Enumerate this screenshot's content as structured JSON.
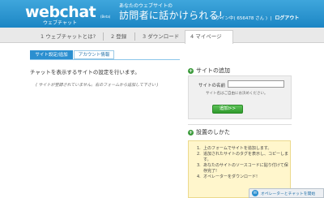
{
  "header": {
    "logo": "webchat",
    "logo_reg": "(Beta)",
    "logo_sub": "ウェブチャット",
    "tagline_small": "あなたのウェブサイトの",
    "tagline_big": "訪問者に話かけられる!",
    "login_status": "ログイン中( 656478 さん )",
    "logout": "ログアウト"
  },
  "nav": {
    "tabs": [
      {
        "label": "1 ウェブチャットとは?"
      },
      {
        "label": "2 登録"
      },
      {
        "label": "3 ダウンロード"
      },
      {
        "label": "4 マイページ"
      }
    ]
  },
  "main": {
    "sub_tabs": [
      {
        "label": "サイト設定/追加",
        "active": true
      },
      {
        "label": "アカウント情報",
        "active": false
      }
    ],
    "intro": "チャットを表示するサイトの設定を行います。",
    "note": "( サイトが登録されていません。右のフォームから追加して下さい )"
  },
  "sidebar": {
    "add_site": {
      "heading": "サイトの追加",
      "name_label": "サイトの名前",
      "name_value": "",
      "help": "サイト名はご自由にお決めください。",
      "button": "追加>>"
    },
    "setup": {
      "heading": "設置のしかた",
      "steps": [
        {
          "num": "1.",
          "text": "上のフォームでサイトを追加します。"
        },
        {
          "num": "2.",
          "text": "追加されたサイトのタグを表示し、コピーします。"
        },
        {
          "num": "3.",
          "text": "あなたのサイトのソースコードに貼り付けて保存完了!"
        },
        {
          "num": "4.",
          "text": "オペレーターをダウンロード!"
        }
      ]
    }
  },
  "chat_widget": {
    "label": "オペレーターとチャットを開始"
  },
  "colors": {
    "header": "#2b8fd0",
    "button_green": "#3a9a3a",
    "setup_bg": "#fff6cc"
  }
}
